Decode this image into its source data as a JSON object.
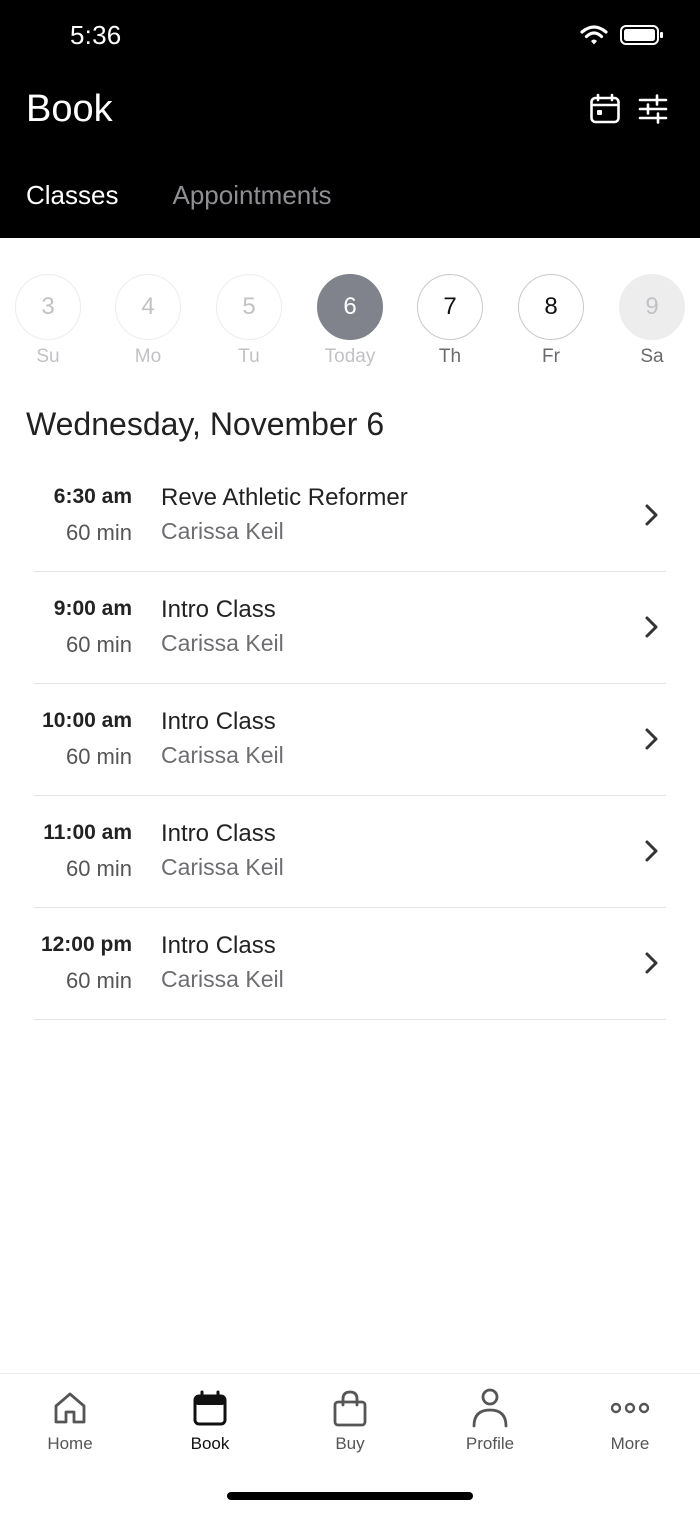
{
  "status_bar": {
    "time": "5:36"
  },
  "header": {
    "title": "Book",
    "calendar_icon": "calendar-icon",
    "filter_icon": "filter-sliders-icon"
  },
  "tabs": [
    {
      "label": "Classes",
      "active": true
    },
    {
      "label": "Appointments",
      "active": false
    }
  ],
  "week": [
    {
      "number": "3",
      "label": "Su",
      "state": "past"
    },
    {
      "number": "4",
      "label": "Mo",
      "state": "past"
    },
    {
      "number": "5",
      "label": "Tu",
      "state": "past"
    },
    {
      "number": "6",
      "label": "Today",
      "state": "selected"
    },
    {
      "number": "7",
      "label": "Th",
      "state": "future"
    },
    {
      "number": "8",
      "label": "Fr",
      "state": "future"
    },
    {
      "number": "9",
      "label": "Sa",
      "state": "disabled"
    }
  ],
  "date_heading": "Wednesday, November 6",
  "classes": [
    {
      "time": "6:30 am",
      "duration": "60 min",
      "name": "Reve Athletic Reformer",
      "instructor": "Carissa Keil"
    },
    {
      "time": "9:00 am",
      "duration": "60 min",
      "name": "Intro Class",
      "instructor": "Carissa Keil"
    },
    {
      "time": "10:00 am",
      "duration": "60 min",
      "name": "Intro Class",
      "instructor": "Carissa Keil"
    },
    {
      "time": "11:00 am",
      "duration": "60 min",
      "name": "Intro Class",
      "instructor": "Carissa Keil"
    },
    {
      "time": "12:00 pm",
      "duration": "60 min",
      "name": "Intro Class",
      "instructor": "Carissa Keil"
    }
  ],
  "bottom_nav": [
    {
      "label": "Home",
      "icon": "home-icon",
      "active": false
    },
    {
      "label": "Book",
      "icon": "calendar-icon",
      "active": true
    },
    {
      "label": "Buy",
      "icon": "shopping-bag-icon",
      "active": false
    },
    {
      "label": "Profile",
      "icon": "person-icon",
      "active": false
    },
    {
      "label": "More",
      "icon": "more-dots-icon",
      "active": false
    }
  ],
  "colors": {
    "header_bg": "#000000",
    "selected_day": "#80838c",
    "inactive_tab": "#8e8e93"
  }
}
